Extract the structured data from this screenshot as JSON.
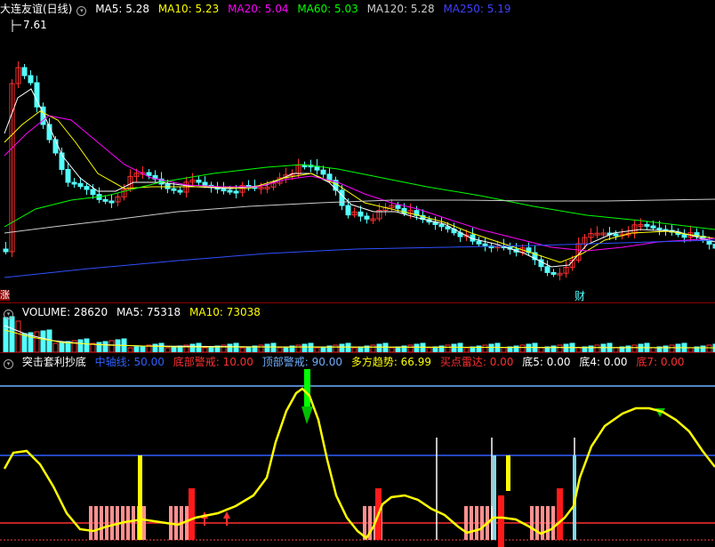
{
  "price_panel": {
    "title": "大连友谊(日线)",
    "indicators": [
      {
        "label": "MA5: 5.28",
        "color": "#ffffff"
      },
      {
        "label": "MA10: 5.23",
        "color": "#ffff00"
      },
      {
        "label": "MA20: 5.04",
        "color": "#ff00ff"
      },
      {
        "label": "MA60: 5.03",
        "color": "#00ff00"
      },
      {
        "label": "MA120: 5.28",
        "color": "#cccccc"
      },
      {
        "label": "MA250: 5.19",
        "color": "#4040ff"
      }
    ],
    "high_label": "7.61",
    "left_tag": "涨",
    "event_tag": "财"
  },
  "volume_panel": {
    "indicators": [
      {
        "label": "VOLUME: 28620",
        "color": "#ffffff"
      },
      {
        "label": "MA5: 75318",
        "color": "#ffffff"
      },
      {
        "label": "MA10: 73038",
        "color": "#ffff00"
      }
    ]
  },
  "indicator_panel": {
    "title": "突击套利抄底",
    "indicators": [
      {
        "label": "中轴线: 50.00",
        "color": "#3060ff"
      },
      {
        "label": "底部警戒: 10.00",
        "color": "#ff3030"
      },
      {
        "label": "顶部警戒: 90.00",
        "color": "#6fb0ff"
      },
      {
        "label": "多方趋势: 66.99",
        "color": "#ffff00"
      },
      {
        "label": "买点雷达: 0.00",
        "color": "#ff3030"
      },
      {
        "label": "底5: 0.00",
        "color": "#ffffff"
      },
      {
        "label": "底4: 0.00",
        "color": "#ffffff"
      },
      {
        "label": "底7: 0.00",
        "color": "#ff3030"
      }
    ]
  },
  "colors": {
    "up": "#ff3030",
    "down": "#54ffff",
    "separator": "#8b0000"
  }
}
